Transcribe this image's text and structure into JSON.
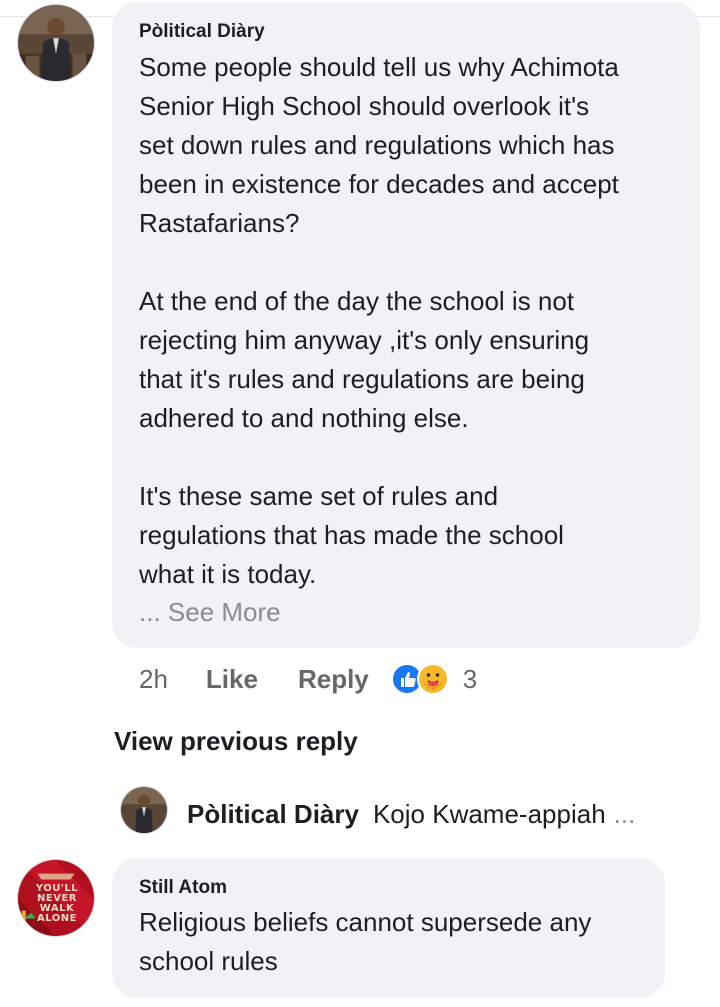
{
  "comment1": {
    "author": "Pòlitical Diàry",
    "lines": [
      "Some people should tell us why Achimota",
      "Senior High School should overlook it's",
      "set down rules and regulations which has",
      "been in existence for decades and accept",
      "Rastafarians?",
      "",
      "At the end of the day the school is not",
      "rejecting him anyway ,it's only ensuring",
      "that it's rules and regulations are being",
      "adhered to and nothing else.",
      "",
      "It's these same set of rules and",
      "regulations that has made the school",
      "what it is today."
    ],
    "see_more": "... See More",
    "time": "2h",
    "like_label": "Like",
    "reply_label": "Reply",
    "reactions": [
      "like-icon",
      "care-icon"
    ],
    "reaction_count": "3"
  },
  "view_previous_reply": "View previous reply",
  "nested_reply": {
    "author": "Pòlitical Diàry",
    "snippet": "Kojo Kwame-appiah",
    "ellipsis": "..."
  },
  "comment2": {
    "author": "Still Atom",
    "lines": [
      "Religious beliefs cannot supersede any",
      "school rules"
    ],
    "avatar_text": "YOU'LL NEVER WALK ALONE"
  },
  "colors": {
    "bubble": "#f0f2f5",
    "text": "#1c1e21",
    "muted": "#65676b",
    "like_blue": "#1877f2",
    "care_yellow": "#f7b928"
  }
}
